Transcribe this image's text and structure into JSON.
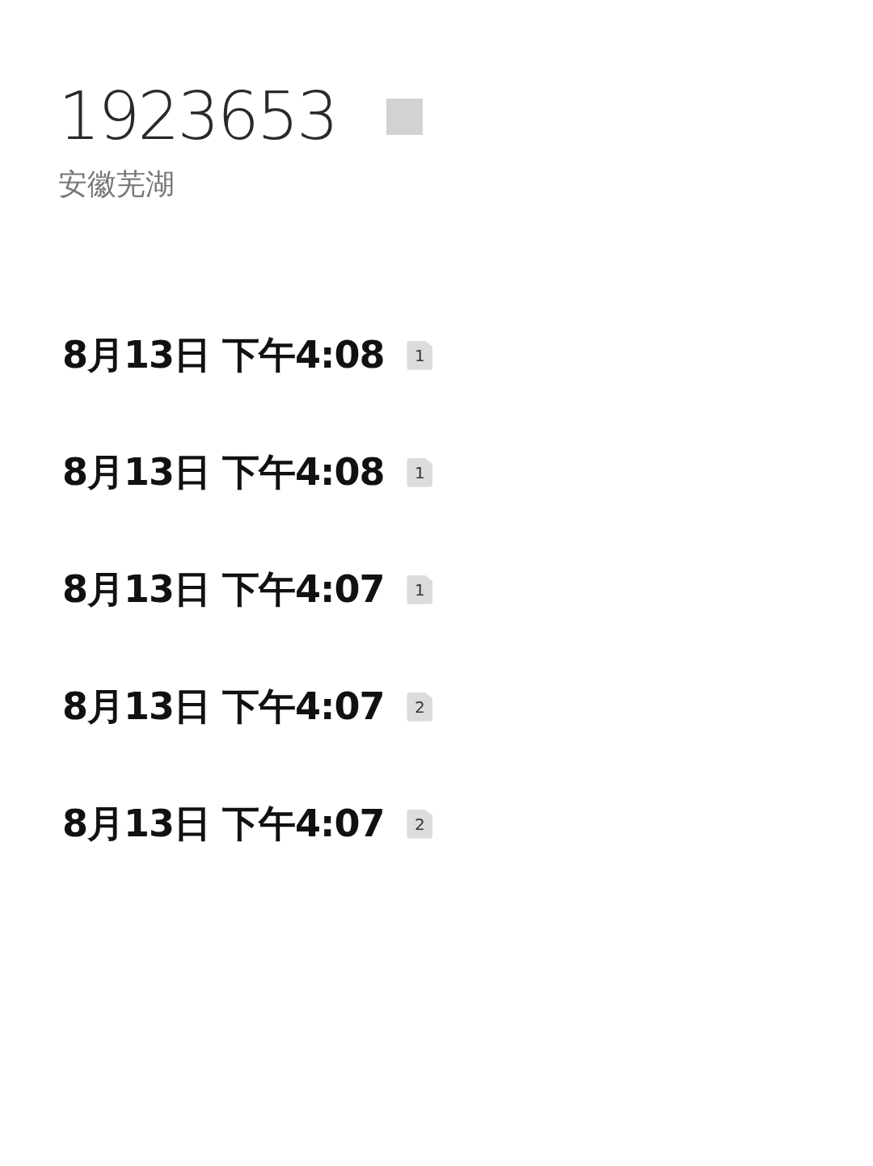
{
  "contact": {
    "number": "1923653",
    "location": "安徽芜湖"
  },
  "calls": [
    {
      "time": "8月13日 下午4:08",
      "sim": "1"
    },
    {
      "time": "8月13日 下午4:08",
      "sim": "1"
    },
    {
      "time": "8月13日 下午4:07",
      "sim": "1"
    },
    {
      "time": "8月13日 下午4:07",
      "sim": "2"
    },
    {
      "time": "8月13日 下午4:07",
      "sim": "2"
    }
  ]
}
